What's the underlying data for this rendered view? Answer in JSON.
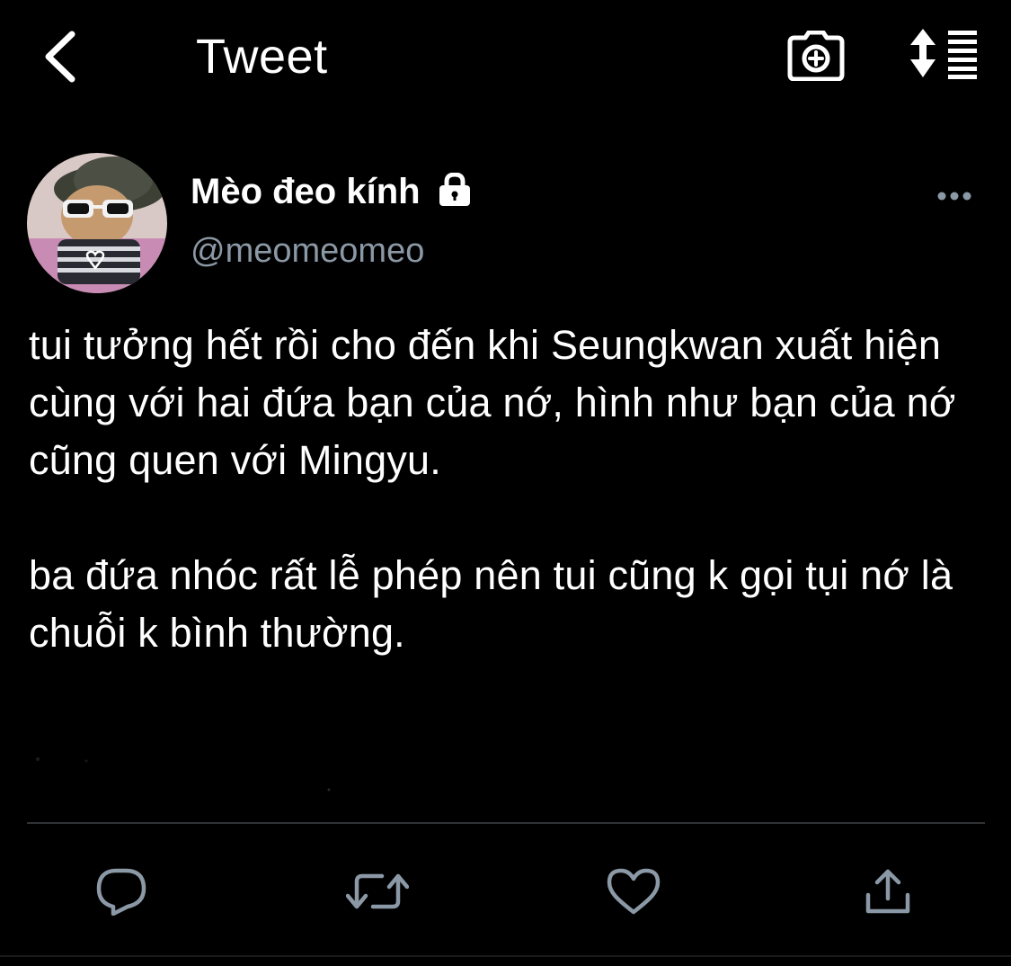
{
  "header": {
    "title": "Tweet",
    "back_icon": "chevron-left-icon",
    "camera_icon": "camera-plus-icon",
    "sort_icon": "sort-list-icon"
  },
  "author": {
    "display_name": "Mèo đeo kính",
    "handle": "@meomeomeo",
    "protected_icon": "lock-icon",
    "avatar": "cat-with-sunglasses-avatar"
  },
  "tweet": {
    "paragraphs": [
      "tui tưởng hết rồi cho đến khi Seungkwan xuất hiện cùng với  hai đứa bạn của nớ, hình như bạn của nớ cũng quen với Mingyu.",
      "ba đứa nhóc rất lễ phép nên tui cũng k gọi tụi nớ là chuỗi k bình thường."
    ]
  },
  "actions": {
    "reply_icon": "reply-icon",
    "retweet_icon": "retweet-icon",
    "like_icon": "heart-icon",
    "share_icon": "share-icon"
  },
  "colors": {
    "background": "#000000",
    "text_primary": "#ffffff",
    "text_secondary": "#8b98a5",
    "icon_muted": "#8b98a5",
    "divider": "#2f3336"
  }
}
